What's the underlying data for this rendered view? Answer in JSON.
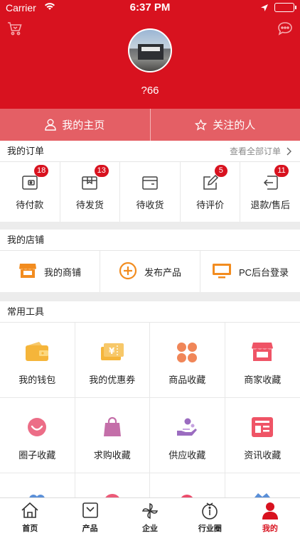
{
  "status": {
    "carrier": "Carrier",
    "time": "6:37 PM"
  },
  "profile": {
    "username": "?66",
    "home_label": "我的主页",
    "follow_label": "关注的人"
  },
  "orders": {
    "title": "我的订单",
    "view_all": "查看全部订单",
    "items": [
      {
        "label": "待付款",
        "badge": "18",
        "icon": "wallet-icon"
      },
      {
        "label": "待发货",
        "badge": "13",
        "icon": "package-icon"
      },
      {
        "label": "待收货",
        "badge": "",
        "icon": "receive-box-icon"
      },
      {
        "label": "待评价",
        "badge": "5",
        "icon": "edit-review-icon"
      },
      {
        "label": "退款/售后",
        "badge": "11",
        "icon": "return-icon"
      }
    ]
  },
  "shop": {
    "title": "我的店铺",
    "items": [
      {
        "label": "我的商铺",
        "icon": "storefront-icon"
      },
      {
        "label": "发布产品",
        "icon": "plus-circle-icon"
      },
      {
        "label": "PC后台登录",
        "icon": "monitor-icon"
      }
    ]
  },
  "tools": {
    "title": "常用工具",
    "items": [
      {
        "label": "我的钱包",
        "icon": "wallet-icon"
      },
      {
        "label": "我的优惠券",
        "icon": "coupon-icon"
      },
      {
        "label": "商品收藏",
        "icon": "product-favorite-icon"
      },
      {
        "label": "商家收藏",
        "icon": "merchant-favorite-icon"
      },
      {
        "label": "圈子收藏",
        "icon": "circle-favorite-icon"
      },
      {
        "label": "求购收藏",
        "icon": "shopping-bag-icon"
      },
      {
        "label": "供应收藏",
        "icon": "supply-icon"
      },
      {
        "label": "资讯收藏",
        "icon": "news-icon"
      }
    ]
  },
  "tabs": [
    {
      "label": "首页",
      "icon": "home-icon"
    },
    {
      "label": "产品",
      "icon": "product-icon"
    },
    {
      "label": "企业",
      "icon": "pinwheel-icon"
    },
    {
      "label": "行业圈",
      "icon": "info-circle-icon"
    },
    {
      "label": "我的",
      "icon": "user-icon",
      "active": true
    }
  ],
  "colors": {
    "brand_red": "#d8121f",
    "bar_pink": "#e45f65",
    "orange": "#f28c1f"
  }
}
